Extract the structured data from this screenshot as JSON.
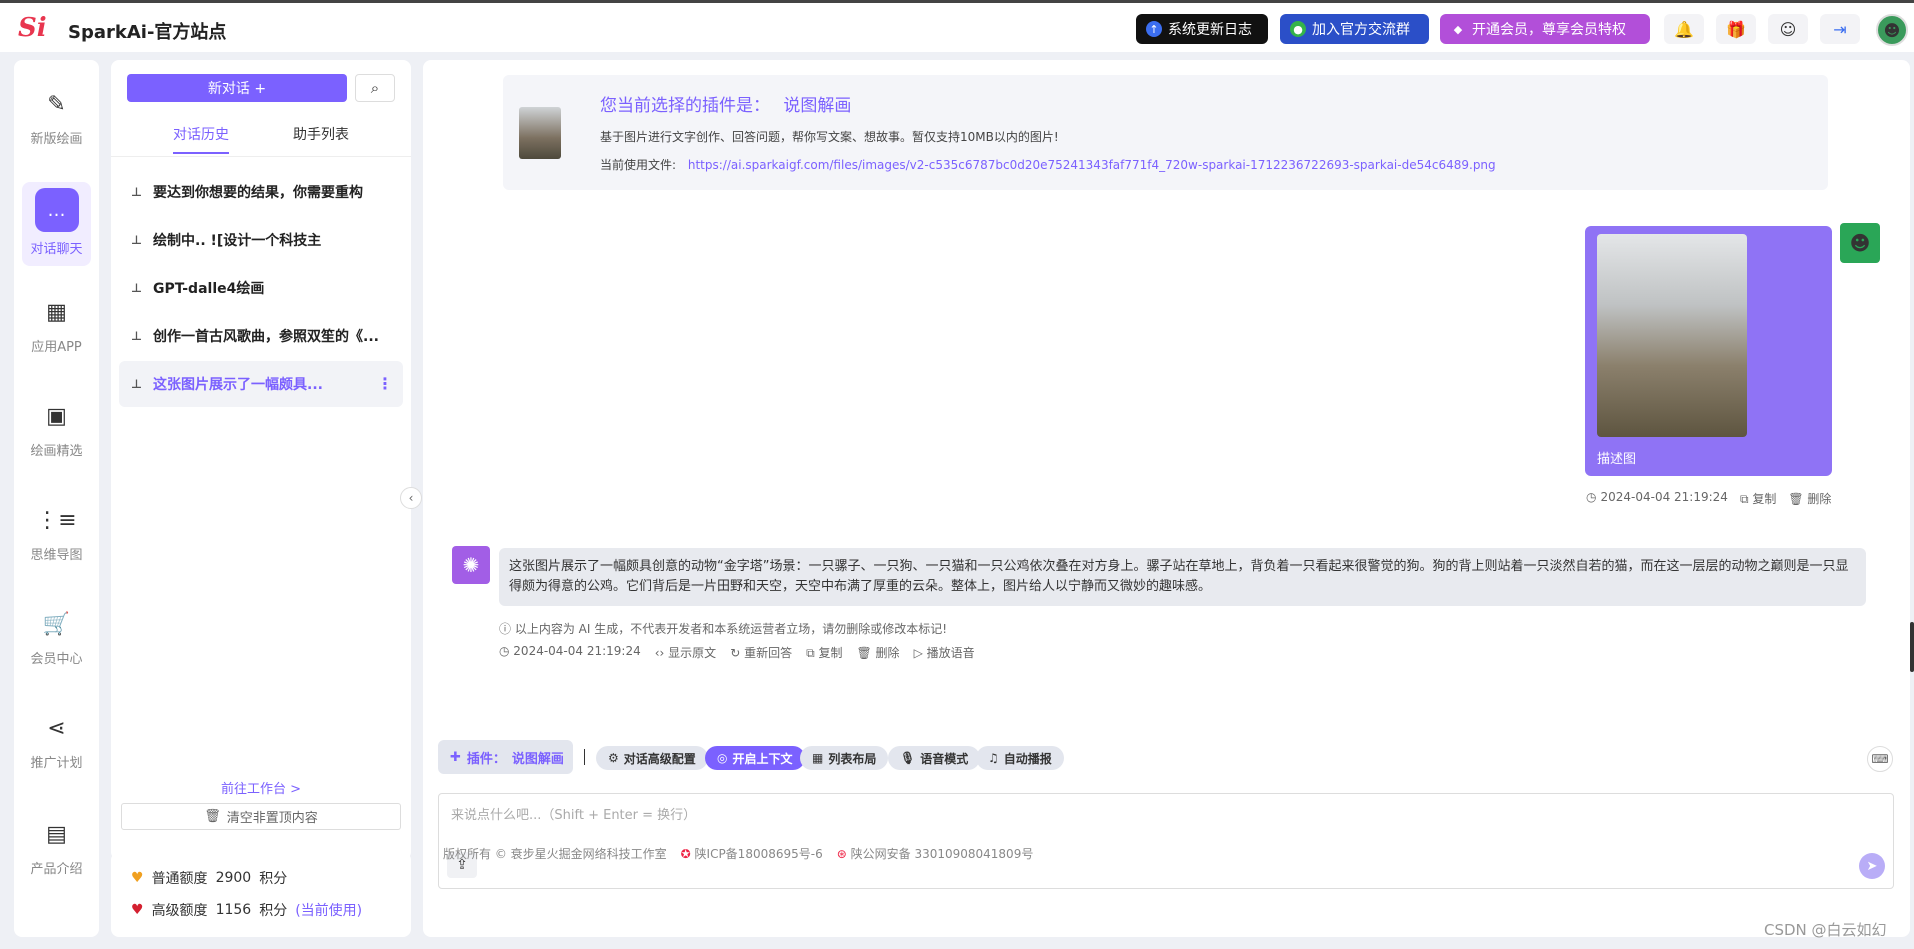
{
  "header": {
    "logo": "Si",
    "title": "SparkAi-官方站点",
    "buttons": [
      {
        "label": "系统更新日志",
        "icon": "upload-circle-icon"
      },
      {
        "label": "加入官方交流群",
        "icon": "wechat-icon"
      },
      {
        "label": "开通会员，尊享会员特权",
        "icon": "diamond-icon"
      }
    ],
    "icons": [
      "bell-icon",
      "gift-icon",
      "smile-icon",
      "login-icon",
      "avatar"
    ]
  },
  "rail": {
    "items": [
      {
        "label": "新版绘画",
        "icon": "pen-icon"
      },
      {
        "label": "对话聊天",
        "icon": "chat-icon"
      },
      {
        "label": "应用APP",
        "icon": "grid-icon"
      },
      {
        "label": "绘画精选",
        "icon": "image-icon"
      },
      {
        "label": "思维导图",
        "icon": "mindmap-icon"
      },
      {
        "label": "会员中心",
        "icon": "cart-icon"
      },
      {
        "label": "推广计划",
        "icon": "share-icon"
      },
      {
        "label": "产品介绍",
        "icon": "box-icon"
      }
    ]
  },
  "sidebar": {
    "new_chat": "新对话 +",
    "tabs": [
      "对话历史",
      "助手列表"
    ],
    "conversations": [
      "要达到你想要的结果，你需要重构",
      "绘制中.. ![设计一个科技主",
      "GPT-dalle4绘画",
      "创作一首古风歌曲，参照双笙的《...",
      "这张图片展示了一幅颇具..."
    ],
    "workbench": "前往工作台 >",
    "clear": "清空非置顶内容"
  },
  "quota": {
    "normal_label": "普通额度",
    "normal_value": "2900",
    "unit": "积分",
    "advanced_label": "高级额度",
    "advanced_value": "1156",
    "in_use": "(当前使用)"
  },
  "plugin": {
    "title_prefix": "您当前选择的插件是：",
    "name": "说图解画",
    "desc": "基于图片进行文字创作、回答问题，帮你写文案、想故事。暂仅支持10MB以内的图片!",
    "file_label": "当前使用文件:",
    "file_url": "https://ai.sparkaigf.com/files/images/v2-c535c6787bc0d20e75241343faf771f4_720w-sparkai-1712236722693-sparkai-de54c6489.png"
  },
  "user_msg": {
    "caption": "描述图",
    "time": "2024-04-04 21:19:24",
    "copy": "复制",
    "delete": "删除"
  },
  "ai_msg": {
    "text": "这张图片展示了一幅颇具创意的动物“金字塔”场景：一只骡子、一只狗、一只猫和一只公鸡依次叠在对方身上。骡子站在草地上，背负着一只看起来很警觉的狗。狗的背上则站着一只淡然自若的猫，而在这一层层的动物之巅则是一只显得颇为得意的公鸡。它们背后是一片田野和天空，天空中布满了厚重的云朵。整体上，图片给人以宁静而又微妙的趣味感。",
    "note": "以上内容为 AI 生成，不代表开发者和本系统运营者立场，请勿删除或修改本标记!",
    "time": "2024-04-04 21:19:24",
    "actions": [
      "显示原文",
      "重新回答",
      "复制",
      "删除",
      "播放语音"
    ]
  },
  "toolbar": {
    "plugin_label": "插件：",
    "plugin_name": "说图解画",
    "chips": [
      "对话高级配置",
      "开启上下文",
      "列表布局",
      "语音模式",
      "自动播报"
    ]
  },
  "input": {
    "placeholder": "来说点什么吧...（Shift + Enter = 换行）"
  },
  "footer": {
    "copyright": "版权所有 © 衰步星火掘金网络科技工作室",
    "icp": "陕ICP备18008695号-6",
    "police": "陕公网安备 33010908041809号"
  },
  "watermark": "CSDN @白云如幻",
  "colors": {
    "accent": "#7b61ff",
    "user_bubble": "#8f73f5",
    "ai_avatar": "#a25ee6"
  }
}
